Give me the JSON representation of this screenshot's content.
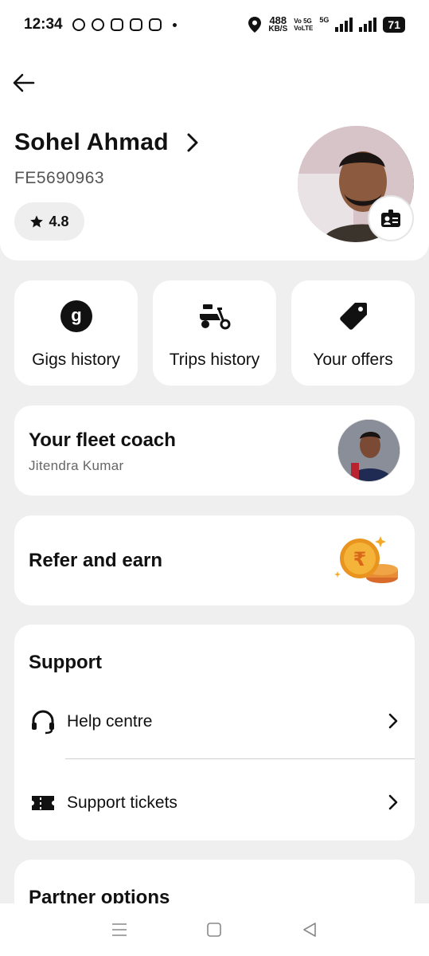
{
  "status_bar": {
    "time": "12:34",
    "net_speed_value": "488",
    "net_speed_unit": "KB/S",
    "volte_top": "Vo 5G",
    "volte_bottom": "VoLTE",
    "network_type": "5G",
    "battery": "71",
    "left_icons": [
      "whatsapp-icon",
      "chat-icon",
      "instagram-icon",
      "instagram-icon",
      "instagram-icon"
    ]
  },
  "profile": {
    "name": "Sohel Ahmad",
    "id": "FE5690963",
    "rating": "4.8"
  },
  "quick_actions": [
    {
      "label": "Gigs history",
      "icon": "gigs-icon"
    },
    {
      "label": "Trips history",
      "icon": "scooter-icon"
    },
    {
      "label": "Your offers",
      "icon": "tag-icon"
    }
  ],
  "fleet_coach": {
    "title": "Your fleet coach",
    "name": "Jitendra Kumar"
  },
  "refer": {
    "title": "Refer and earn",
    "coin_symbol": "₹"
  },
  "support": {
    "title": "Support",
    "items": [
      {
        "label": "Help centre",
        "icon": "headset-icon"
      },
      {
        "label": "Support tickets",
        "icon": "ticket-icon"
      }
    ]
  },
  "partner": {
    "title": "Partner options"
  },
  "colors": {
    "background": "#efefef",
    "card": "#ffffff",
    "coin": "#f4a823"
  }
}
